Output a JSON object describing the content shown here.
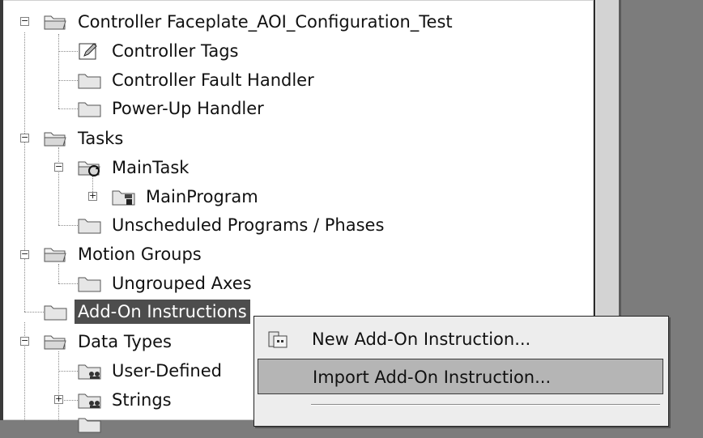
{
  "tree": {
    "controller": "Controller Faceplate_AOI_Configuration_Test",
    "controller_tags": "Controller Tags",
    "controller_fault_handler": "Controller Fault Handler",
    "power_up_handler": "Power-Up Handler",
    "tasks": "Tasks",
    "main_task": "MainTask",
    "main_program": "MainProgram",
    "unscheduled": "Unscheduled Programs / Phases",
    "motion_groups": "Motion Groups",
    "ungrouped_axes": "Ungrouped Axes",
    "add_on_instructions": "Add-On Instructions",
    "data_types": "Data Types",
    "user_defined": "User-Defined",
    "strings": "Strings"
  },
  "context_menu": {
    "new_aoi": "New Add-On Instruction...",
    "import_aoi": "Import Add-On Instruction..."
  }
}
